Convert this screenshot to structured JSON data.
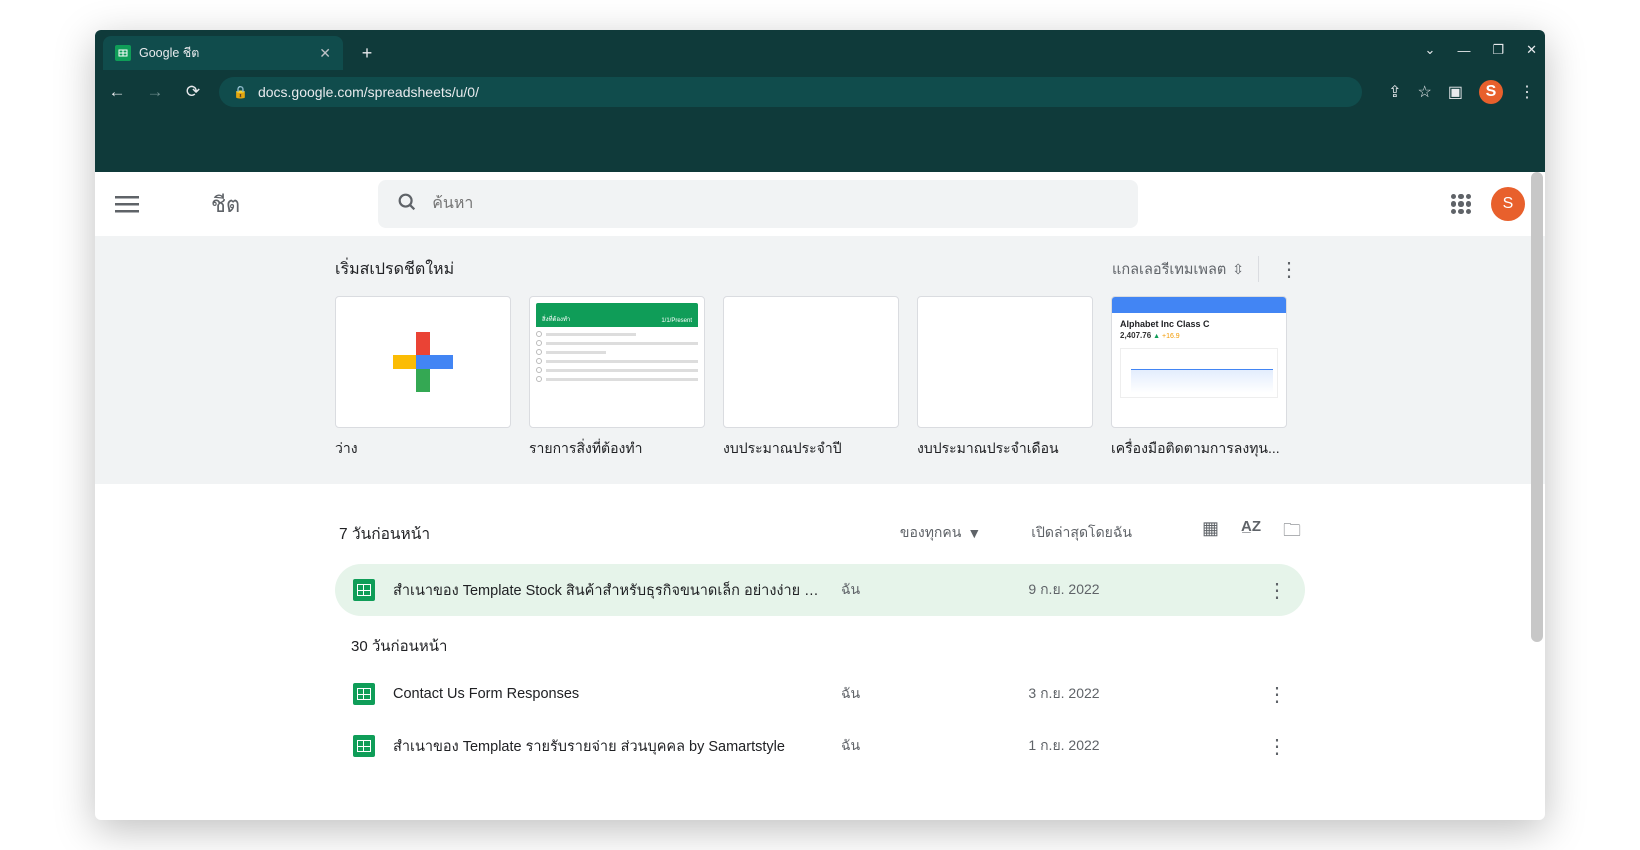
{
  "browser": {
    "tab_title": "Google ชีต",
    "url_display": "docs.google.com/spreadsheets/u/0/",
    "avatar_letter": "S"
  },
  "header": {
    "app_title": "ชีต",
    "search_placeholder": "ค้นหา",
    "avatar_letter": "S"
  },
  "gallery": {
    "heading": "เริ่มสเปรดชีตใหม่",
    "gallery_link": "แกลเลอรีเทมเพลต",
    "templates": [
      {
        "label": "ว่าง"
      },
      {
        "label": "รายการสิ่งที่ต้องทำ"
      },
      {
        "label": "งบประมาณประจำปี"
      },
      {
        "label": "งบประมาณประจำเดือน"
      },
      {
        "label": "เครื่องมือติดตามการลงทุน..."
      }
    ],
    "investment_preview": {
      "title": "Alphabet Inc Class C",
      "price": "2,407.76"
    }
  },
  "doclist": {
    "filter_owner": "ของทุกคน",
    "opened_label": "เปิดล่าสุดโดยฉัน",
    "sections": [
      {
        "label": "7 วันก่อนหน้า",
        "rows": [
          {
            "title": "สำเนาของ Template Stock สินค้าสำหรับธุรกิจขนาดเล็ก อย่างง่าย b...",
            "owner": "ฉัน",
            "date": "9 ก.ย. 2022",
            "highlight": true
          }
        ]
      },
      {
        "label": "30 วันก่อนหน้า",
        "rows": [
          {
            "title": "Contact Us Form Responses",
            "owner": "ฉัน",
            "date": "3 ก.ย. 2022",
            "highlight": false
          },
          {
            "title": "สำเนาของ Template รายรับรายจ่าย ส่วนบุคคล by Samartstyle",
            "owner": "ฉัน",
            "date": "1 ก.ย. 2022",
            "highlight": false
          }
        ]
      }
    ]
  }
}
